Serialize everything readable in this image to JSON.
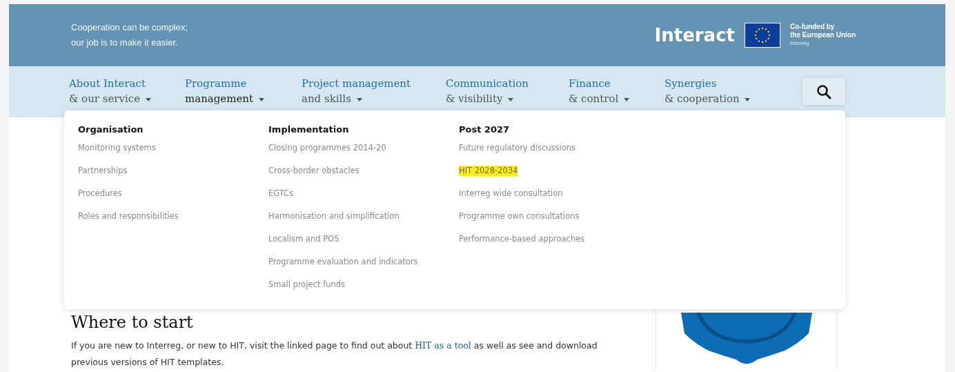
{
  "header": {
    "tagline": [
      "Cooperation can be complex;",
      "our job is to make it easier."
    ],
    "logo": "Interact",
    "eu_badge": {
      "line_1": "Co-funded by",
      "line_2": "the European Union",
      "line_3": "Interreg"
    }
  },
  "nav": {
    "items": [
      {
        "top": "About Interact",
        "bottom": "& our service",
        "expanded": false
      },
      {
        "top": "Programme",
        "bottom": "management",
        "expanded": true
      },
      {
        "top": "Project management",
        "bottom": "and skills",
        "expanded": false
      },
      {
        "top": "Communication",
        "bottom": "& visibility",
        "expanded": false
      },
      {
        "top": "Finance",
        "bottom": "& control",
        "expanded": false
      },
      {
        "top": "Synergies",
        "bottom": "& cooperation",
        "expanded": false
      }
    ]
  },
  "dropdown": {
    "columns": [
      {
        "heading": "Organisation",
        "links": [
          {
            "label": "Monitoring systems",
            "highlighted": false
          },
          {
            "label": "Partnerships",
            "highlighted": false
          },
          {
            "label": "Procedures",
            "highlighted": false
          },
          {
            "label": "Roles and responsibilities",
            "highlighted": false
          }
        ]
      },
      {
        "heading": "Implementation",
        "links": [
          {
            "label": "Closing programmes 2014-20",
            "highlighted": false
          },
          {
            "label": "Cross-border obstacles",
            "highlighted": false
          },
          {
            "label": "EGTCs",
            "highlighted": false
          },
          {
            "label": "Harmonisation and simplification",
            "highlighted": false
          },
          {
            "label": "Localism and PO5",
            "highlighted": false
          },
          {
            "label": "Programme evaluation and indicators",
            "highlighted": false
          },
          {
            "label": "Small project funds",
            "highlighted": false
          }
        ]
      },
      {
        "heading": "Post 2027",
        "links": [
          {
            "label": "Future regulatory discussions",
            "highlighted": false
          },
          {
            "label": "HIT 2028-2034",
            "highlighted": true
          },
          {
            "label": "Interreg wide consultation",
            "highlighted": false
          },
          {
            "label": "Programme own consultations",
            "highlighted": false
          },
          {
            "label": "Performance-based approaches",
            "highlighted": false
          }
        ]
      }
    ]
  },
  "content": {
    "heading": "Where to start",
    "paragraph": {
      "before": "If you are new to Interreg, or new to HIT, visit the linked page to find out about ",
      "link": "HIT as a tool",
      "after": " as well as see and download previous versions of HIT templates."
    }
  }
}
